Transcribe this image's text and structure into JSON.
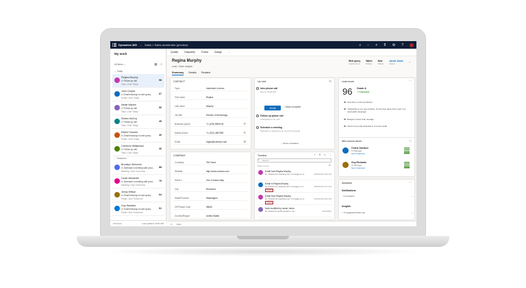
{
  "topbar": {
    "app_name": "Dynamics 365",
    "breadcrumb": "Sales  >  Sales accelerator (preview)",
    "icons": [
      "search-icon",
      "lightbulb-icon",
      "plus-icon",
      "filter-icon",
      "gear-icon",
      "help-icon",
      "avatar"
    ]
  },
  "left": {
    "title": "My work",
    "filter": "All items",
    "group_today": "Today",
    "group_tomorrow": "Tomorrow",
    "footer_count": "112 items",
    "footer_updated": "Last updated: 10:01 AM",
    "today": [
      {
        "name": "Regina Murphy",
        "activity": "Follow up call",
        "sub": "Task • Due Today",
        "count": "98",
        "color": "#c239b3"
      },
      {
        "name": "John Cooper",
        "activity": "Email followup to web query",
        "sub": "Email • Due Today",
        "count": "67",
        "color": "#0f6cbd"
      },
      {
        "name": "Neale Warren",
        "activity": "Follow up call",
        "sub": "Task • Due Today",
        "count": "56",
        "color": "#8764b8"
      },
      {
        "name": "Shawn McCoy",
        "activity": "Follow up call",
        "sub": "Task • Due Today",
        "count": "45",
        "color": "#038387"
      },
      {
        "name": "Esther Howard",
        "activity": "Email followup to web query",
        "sub": "Email • Due Today",
        "count": "40",
        "color": "#ca5010"
      },
      {
        "name": "Cameron Williamson",
        "activity": "Follow up call",
        "sub": "Task • Due Today",
        "count": "36",
        "color": "#498205"
      }
    ],
    "tomorrow": [
      {
        "name": "Brooklyn Simmons",
        "activity": "Schedule a meeting with prod...",
        "sub": "Meeting • Due Tomorrow",
        "count": "88",
        "color": "#4f6bed"
      },
      {
        "name": "Leslie Alexander",
        "activity": "Schedule a meeting with prod...",
        "sub": "Meeting • Due Tomorrow",
        "count": "79",
        "color": "#e3008c"
      },
      {
        "name": "Jenny Wilson",
        "activity": "Email followup to web query",
        "sub": "Email • Due Tomorrow",
        "count": "64",
        "color": "#986f0b"
      },
      {
        "name": "Guy Hawkins",
        "activity": "Email followup to web query",
        "sub": "Email • Due Tomorrow",
        "count": "51",
        "color": "#0078d4"
      }
    ]
  },
  "commands": [
    "Qualify",
    "Disqualify",
    "Follow",
    "Assign",
    "..."
  ],
  "record": {
    "name": "Regina Murphy",
    "subtitle": "Lead • Sales Insights",
    "kpis": [
      {
        "value": "Web query",
        "label": "Lead source"
      },
      {
        "value": "Warm",
        "label": "Rating"
      },
      {
        "value": "New",
        "label": "Status"
      },
      {
        "value": "Jacob Jones",
        "label": "Owner"
      }
    ],
    "tabs": [
      "Summary",
      "Details",
      "Related"
    ]
  },
  "contact": {
    "title": "CONTACT",
    "fields": [
      {
        "label": "Topic",
        "value": "Interested in demo"
      },
      {
        "label": "First name",
        "value": "Regina"
      },
      {
        "label": "Last name",
        "value": "Murphy"
      },
      {
        "label": "Job title",
        "value": "Director of technology"
      },
      {
        "label": "Business phone",
        "value": "+1 (425) 5550194"
      },
      {
        "label": "Mobile phone",
        "value": "+1 (222) 4567890"
      },
      {
        "label": "Email",
        "value": "regina@contoso.com"
      }
    ]
  },
  "company": {
    "title": "COMPANY",
    "fields": [
      {
        "label": "Company",
        "value": "Tell Cloud"
      },
      {
        "label": "Website",
        "value": "http://www.contoso.com"
      },
      {
        "label": "Street 1",
        "value": "One Contoso Way"
      },
      {
        "label": "City",
        "value": "Redmond"
      },
      {
        "label": "State/Province",
        "value": "Washington"
      },
      {
        "label": "ZIP/Postal Code",
        "value": "98052"
      },
      {
        "label": "Country/Region",
        "value": "United States"
      }
    ]
  },
  "upnext": {
    "title": "Up next",
    "items": [
      {
        "title": "Intro phone call",
        "sub": "Due by 10:00 AM"
      },
      {
        "title": "Follow up phone call",
        "sub": "Anticipated to be next"
      },
      {
        "title": "Schedule a meeting",
        "sub": "Schedule a meeting to go over the proposal"
      }
    ],
    "call_label": "Call",
    "complete_label": "Mark complete",
    "show_completed": "Show completed"
  },
  "timeline": {
    "title": "Timeline",
    "search_placeholder": "Search",
    "note_placeholder": "Enter a note...",
    "items": [
      {
        "title": "Email from Regina Murphy",
        "sub": "Hi, Thanks for reaching out, I'm happy to d...",
        "tag": "",
        "date": "8/25/2024 9:06 AM",
        "color": "#c239b3"
      },
      {
        "title": "Email to Regina Murphy",
        "sub": "Hi, thanks for reaching out! I'm happy to d...",
        "tag": "Closed",
        "date": "8/25/2024 9:01 AM",
        "color": "#0f6cbd"
      },
      {
        "title": "Email from Regina Murphy",
        "sub": "Hi, Thanks for reaching out, I'm happy to d...",
        "tag": "Closed",
        "date": "8/24/2024 8:02 AM",
        "color": "#c239b3"
      },
      {
        "title": "Note modified by Jacob Jones",
        "sub": "Hi, thanks for getting back to me...",
        "tag": "",
        "date": "8/23/2024",
        "color": "#8764b8"
      }
    ]
  },
  "leadscore": {
    "title": "Lead score",
    "score": "96",
    "grade": "Grade A",
    "trend": "Improving",
    "bullets": [
      "Security is a strong industry",
      "\"Subscribe to our new product. It's the best deal of the year\" is a successful campaign",
      "Budget is lower than average",
      "Intent to buy was detected in a recent email"
    ],
    "details": "Details"
  },
  "who": {
    "title": "Who knows whom",
    "people": [
      {
        "name": "Cedric Davison",
        "role": "IT Manager",
        "link": "Get introduced",
        "color": "#0f6cbd"
      },
      {
        "name": "Guy Richards",
        "role": "IT Manager",
        "link": "Get introduced",
        "color": "#986f0b"
      }
    ]
  },
  "assistant": {
    "title": "Assistant",
    "notifications": "Notifications",
    "reminders": "3 reminders",
    "insights": "Insights",
    "suggested": "5 suggested follow ups"
  },
  "status": {
    "left": "Open"
  }
}
